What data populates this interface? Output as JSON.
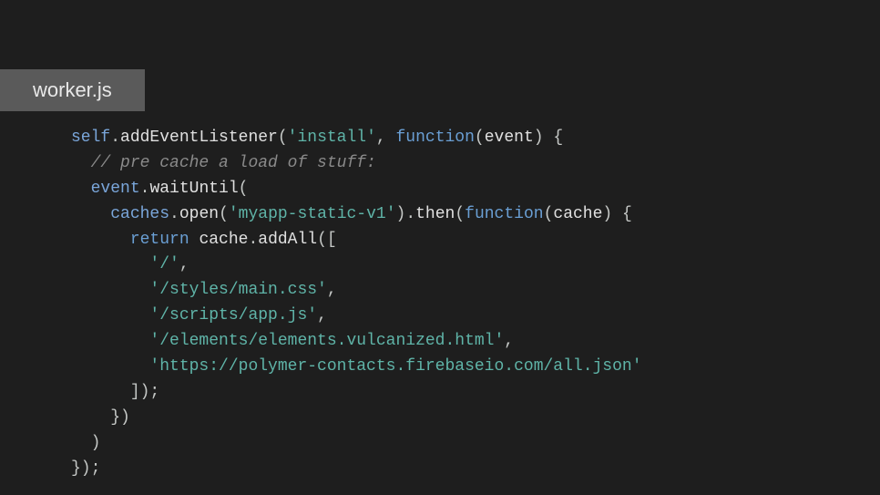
{
  "tab": {
    "filename": "worker.js"
  },
  "code": {
    "l1_self": "self",
    "l1_dot1": ".",
    "l1_method": "addEventListener",
    "l1_paren1": "(",
    "l1_str": "'install'",
    "l1_comma": ", ",
    "l1_func": "function",
    "l1_paren2": "(",
    "l1_param": "event",
    "l1_paren3": ") {",
    "l2_indent": "  ",
    "l2_comment": "// pre cache a load of stuff:",
    "l3_indent": "  ",
    "l3_obj": "event",
    "l3_dot": ".",
    "l3_method": "waitUntil",
    "l3_paren": "(",
    "l4_indent": "    ",
    "l4_obj": "caches",
    "l4_dot": ".",
    "l4_method": "open",
    "l4_paren1": "(",
    "l4_str": "'myapp-static-v1'",
    "l4_paren2": ").",
    "l4_method2": "then",
    "l4_paren3": "(",
    "l4_func": "function",
    "l4_paren4": "(",
    "l4_param": "cache",
    "l4_paren5": ") {",
    "l5_indent": "      ",
    "l5_keyword": "return",
    "l5_space": " ",
    "l5_obj": "cache",
    "l5_dot": ".",
    "l5_method": "addAll",
    "l5_paren": "([",
    "l6_indent": "        ",
    "l6_str": "'/'",
    "l6_comma": ",",
    "l7_indent": "        ",
    "l7_str": "'/styles/main.css'",
    "l7_comma": ",",
    "l8_indent": "        ",
    "l8_str": "'/scripts/app.js'",
    "l8_comma": ",",
    "l9_indent": "        ",
    "l9_str": "'/elements/elements.vulcanized.html'",
    "l9_comma": ",",
    "l10_indent": "        ",
    "l10_str": "'https://polymer-contacts.firebaseio.com/all.json'",
    "l11_indent": "      ",
    "l11_close": "]);",
    "l12_indent": "    ",
    "l12_close": "})",
    "l13_indent": "  ",
    "l13_close": ")",
    "l14_close": "});"
  }
}
